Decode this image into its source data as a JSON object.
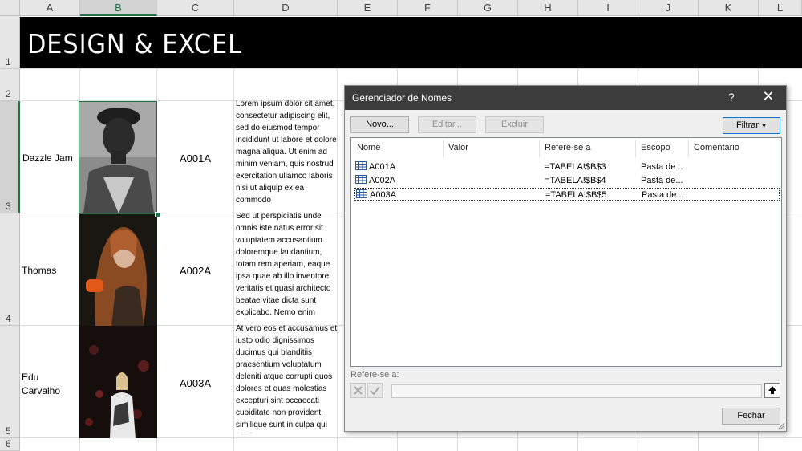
{
  "sheet": {
    "columns": [
      "A",
      "B",
      "C",
      "D",
      "E",
      "F",
      "G",
      "H",
      "I",
      "J",
      "K",
      "L"
    ],
    "rows": [
      "1",
      "2",
      "3",
      "4",
      "5",
      "6"
    ],
    "banner_title": "DESIGN & EXCEL",
    "entries": [
      {
        "name": "Dazzle Jam",
        "code": "A001A",
        "text": "Lorem ipsum dolor sit amet, consectetur adipiscing elit, sed do eiusmod tempor incididunt ut labore et dolore magna aliqua. Ut enim ad minim veniam, quis nostrud exercitation ullamco laboris nisi ut aliquip ex ea commodo"
      },
      {
        "name": "Thomas",
        "code": "A002A",
        "text": "Sed ut perspiciatis unde omnis iste natus error sit voluptatem accusantium doloremque laudantium, totam rem aperiam, eaque ipsa quae ab illo inventore veritatis et quasi architecto beatae vitae dicta sunt explicabo. Nemo enim ipsam"
      },
      {
        "name": "Edu Carvalho",
        "code": "A003A",
        "text": "At vero eos et accusamus et iusto odio dignissimos ducimus qui blanditiis praesentium voluptatum deleniti atque corrupti quos dolores et quas molestias excepturi sint occaecati cupiditate non provident, similique sunt in culpa qui officia"
      }
    ],
    "selection_color": "#217346"
  },
  "dialog": {
    "title": "Gerenciador de Nomes",
    "help": "?",
    "close": "✕",
    "buttons": {
      "new": "Novo...",
      "edit": "Editar...",
      "delete": "Excluir",
      "filter": "Filtrar",
      "close": "Fechar"
    },
    "columns": [
      "Nome",
      "Valor",
      "Refere-se a",
      "Escopo",
      "Comentário"
    ],
    "rows": [
      {
        "name": "A001A",
        "value": "",
        "refers": "=TABELA!$B$3",
        "scope": "Pasta de...",
        "comment": ""
      },
      {
        "name": "A002A",
        "value": "",
        "refers": "=TABELA!$B$4",
        "scope": "Pasta de...",
        "comment": ""
      },
      {
        "name": "A003A",
        "value": "",
        "refers": "=TABELA!$B$5",
        "scope": "Pasta de...",
        "comment": ""
      }
    ],
    "refers_label": "Refere-se a:",
    "refers_value": "",
    "icons": {
      "row": "range-name-icon",
      "cancel": "cancel-x-icon",
      "confirm": "checkmark-icon",
      "collapse": "collapse-arrow-icon"
    },
    "focus_color": "#0078d7"
  }
}
